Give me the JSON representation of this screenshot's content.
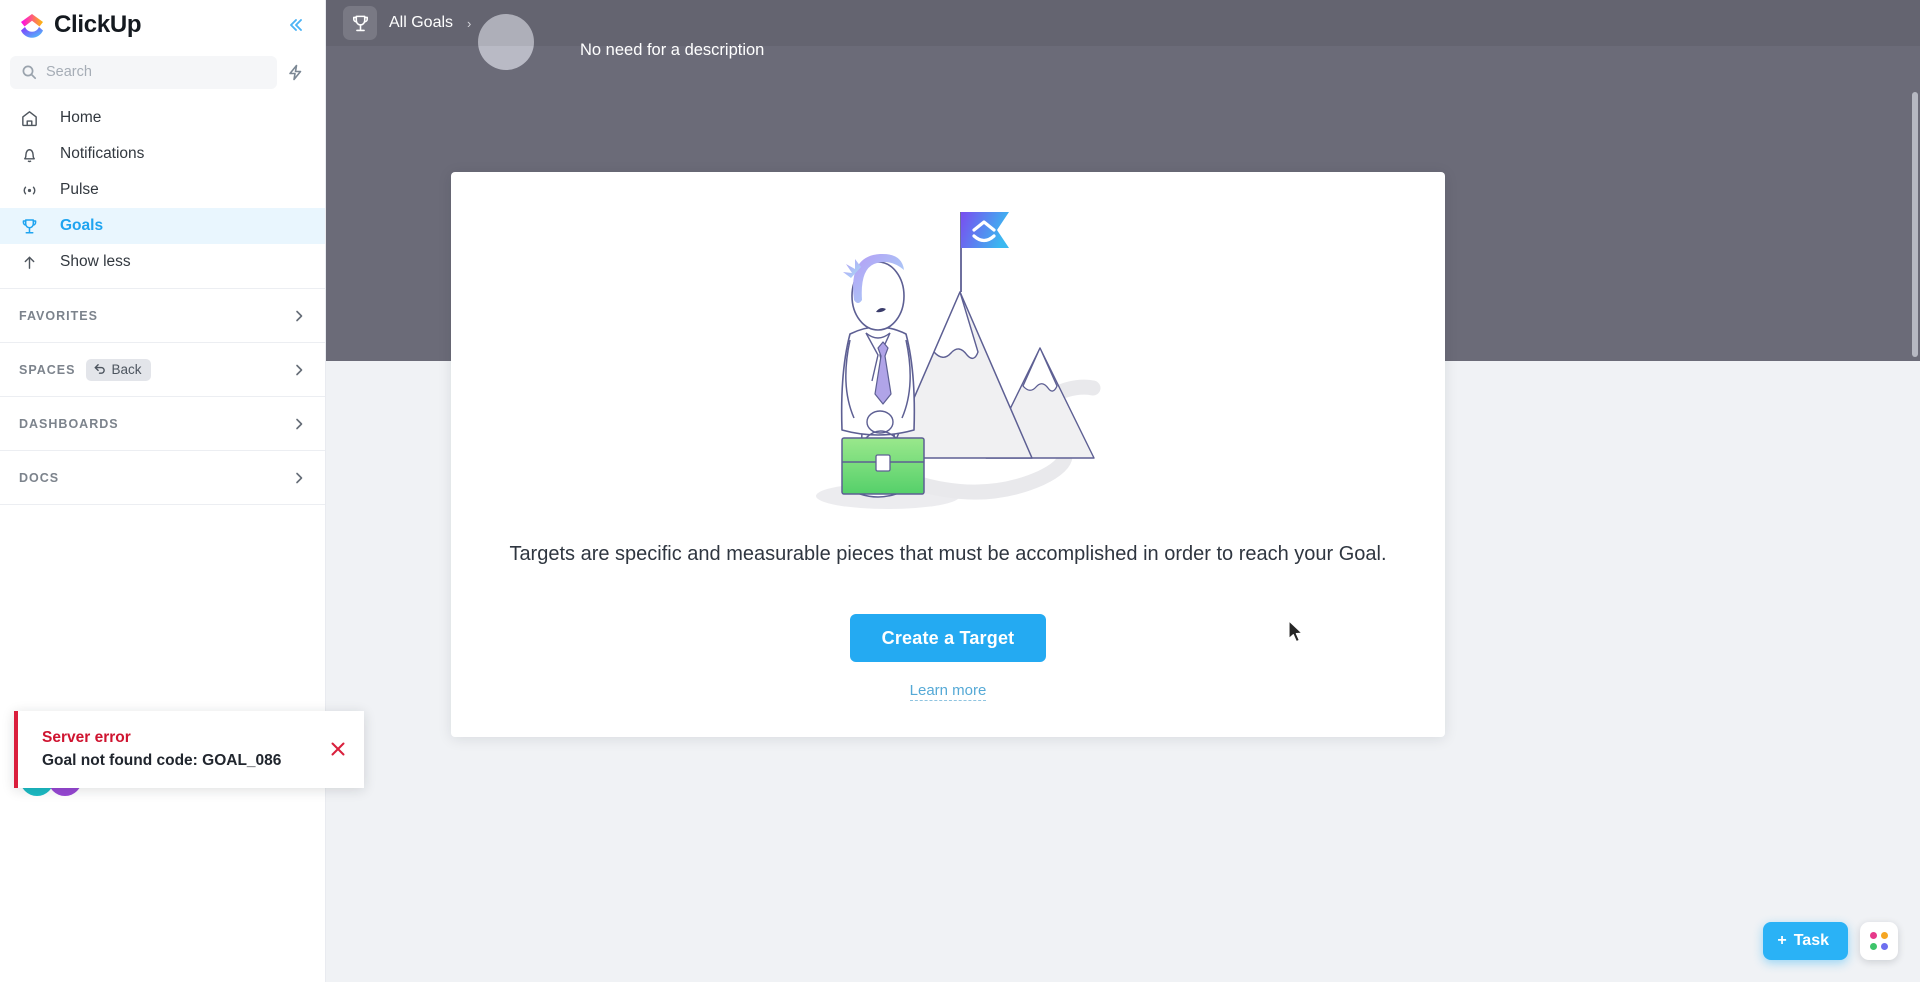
{
  "app": {
    "brand_name": "ClickUp"
  },
  "sidebar": {
    "collapse_icon": "chevrons-left-icon",
    "search": {
      "placeholder": "Search",
      "value": "",
      "icon": "search-icon"
    },
    "bolt_icon": "lightning-bolt-icon",
    "nav_items": [
      {
        "label": "Home",
        "icon": "home-icon",
        "active": false
      },
      {
        "label": "Notifications",
        "icon": "bell-icon",
        "active": false
      },
      {
        "label": "Pulse",
        "icon": "pulse-icon",
        "active": false
      },
      {
        "label": "Goals",
        "icon": "trophy-icon",
        "active": true
      },
      {
        "label": "Show less",
        "icon": "arrow-up-icon",
        "active": false
      }
    ],
    "groups": [
      {
        "title": "FAVORITES",
        "chip": null,
        "chevron": "chevron-right-icon"
      },
      {
        "title": "SPACES",
        "chip": "Back",
        "chip_icon": "undo-arrow-icon",
        "chevron": "chevron-right-icon"
      },
      {
        "title": "DASHBOARDS",
        "chip": null,
        "chevron": "chevron-right-icon"
      },
      {
        "title": "DOCS",
        "chip": null,
        "chevron": "chevron-right-icon"
      }
    ]
  },
  "topbar": {
    "goal_icon": "trophy-icon",
    "breadcrumb": "All Goals",
    "breadcrumb_separator": "›"
  },
  "background_page": {
    "description_placeholder": "No need for a description",
    "avatar": "user-avatar"
  },
  "modal": {
    "illustration": "businessman-with-mountains-and-clickup-flag",
    "description": "Targets are specific and measurable pieces that must be accomplished in order to reach your Goal.",
    "primary_button": "Create a Target",
    "learn_more": "Learn more"
  },
  "toast": {
    "title": "Server error",
    "message": "Goal not found code: GOAL_086",
    "close_icon": "close-x-icon",
    "accent_color": "#da1e3c"
  },
  "bottom_controls": {
    "task_button": "Task",
    "task_plus": "+",
    "apps_icon": "app-grid-icon",
    "apps_colors": [
      "#e6398a",
      "#f5a623",
      "#3dc46a",
      "#6d6ff0"
    ]
  },
  "colors": {
    "accent_blue": "#24aaf2",
    "active_nav": "#1fa4f0",
    "overlay": "#6b6b78",
    "page_bg": "#f0f2f5",
    "error_red": "#cf1430"
  }
}
